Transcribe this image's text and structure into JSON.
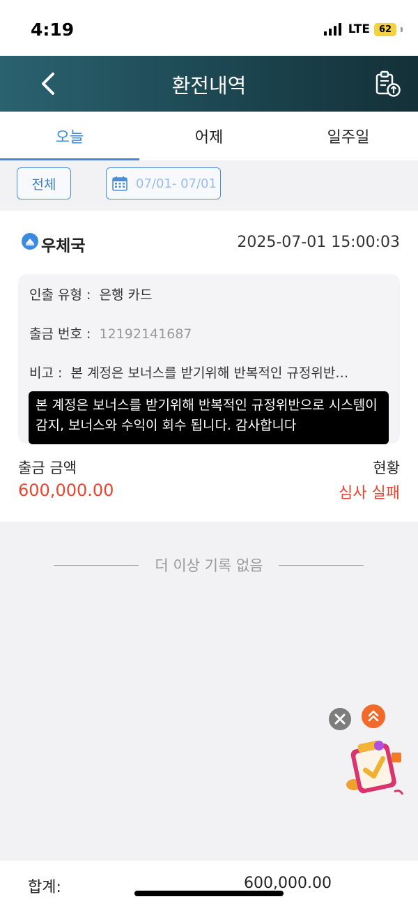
{
  "status_bar": {
    "time": "4:19",
    "network": "LTE",
    "battery": "62"
  },
  "header": {
    "title": "환전내역",
    "back_icon": "chevron-left-icon",
    "export_icon": "clipboard-upload-icon"
  },
  "tabs": [
    {
      "label": "오늘",
      "active": true
    },
    {
      "label": "어제",
      "active": false
    },
    {
      "label": "일주일",
      "active": false
    }
  ],
  "filters": {
    "all_label": "전체",
    "date_range": "07/01- 07/01",
    "calendar_icon": "calendar-icon"
  },
  "record": {
    "bank_name": "우체국",
    "datetime": "2025-07-01 15:00:03",
    "type_label": "인출 유형 :",
    "type_value": "은행 카드",
    "number_label": "출금 번호 :",
    "number_value": "12192141687",
    "remark_label": "비고 :",
    "remark_value": "본 계정은 보너스를 받기위해 반복적인 규정위반…",
    "tooltip": "본 계정은 보너스를 받기위해 반복적인 규정위반으로 시스템이 감지, 보너스와 수익이 회수 됩니다. 감사합니다",
    "amount_label": "출금 금액",
    "amount_value": "600,000.00",
    "status_label": "현황",
    "status_value": "심사 실패"
  },
  "end_of_list": "더 이상 기록 없음",
  "floating": {
    "close_icon": "close-icon",
    "up_icon": "double-chevron-up-icon",
    "gift_icon": "gift-checklist-icon"
  },
  "footer": {
    "total_label": "합계:",
    "total_value": "600,000.00"
  },
  "colors": {
    "accent": "#3d8be0",
    "header_dark": "#143038",
    "header_light": "#2b6270",
    "error": "#e8452c"
  }
}
